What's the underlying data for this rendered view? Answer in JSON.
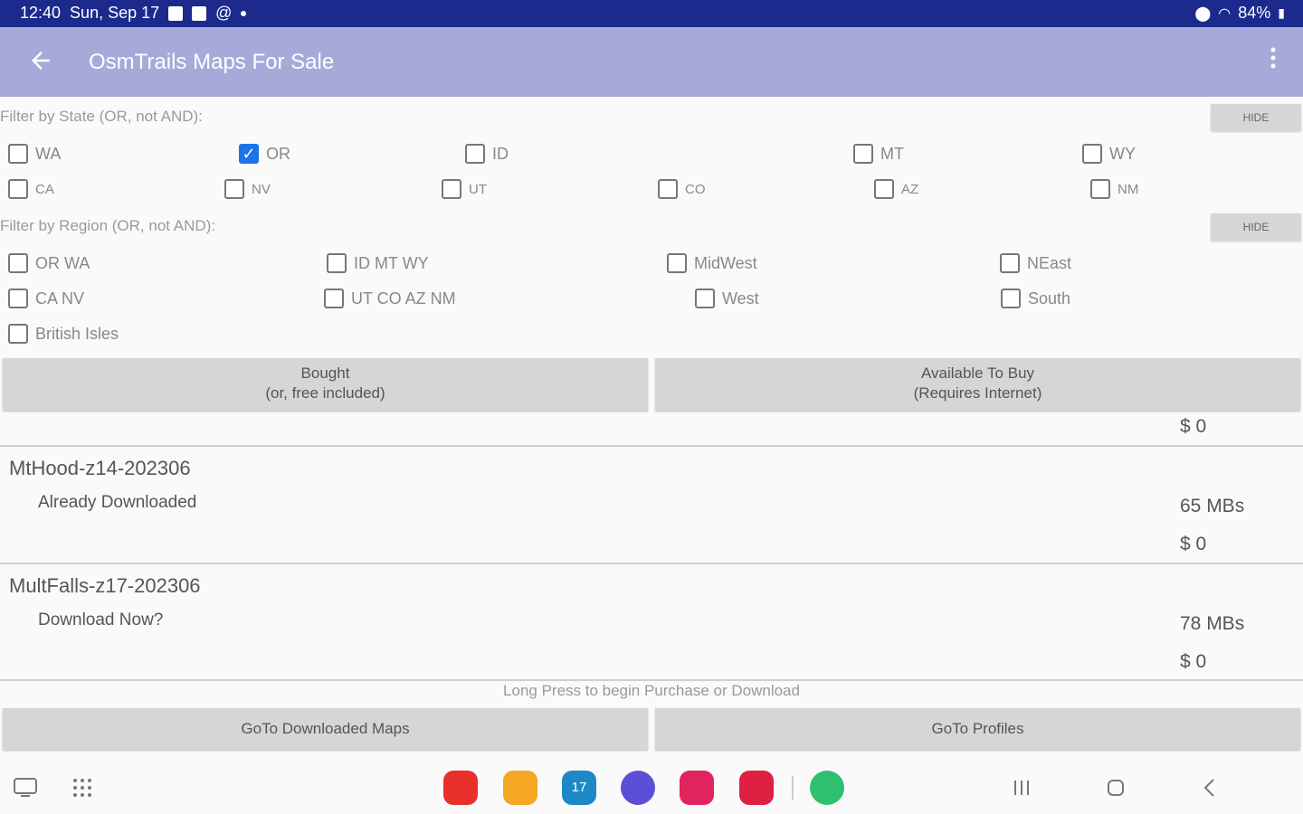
{
  "status_bar": {
    "time": "12:40",
    "date": "Sun, Sep 17",
    "battery": "84%",
    "left_icons": [
      "image-icon",
      "contact-icon",
      "at-icon"
    ],
    "right_icons": [
      "location-icon",
      "wifi-icon",
      "battery-icon"
    ]
  },
  "app_bar": {
    "title": "OsmTrails Maps For Sale",
    "back_icon": "arrow-back-icon",
    "menu_icon": "more-vert-icon"
  },
  "state_filter": {
    "label": "Filter by State (OR, not AND):",
    "hide_label": "HIDE",
    "options": [
      {
        "label": "WA",
        "checked": false
      },
      {
        "label": "OR",
        "checked": true
      },
      {
        "label": "ID",
        "checked": false
      },
      {
        "label": "MT",
        "checked": false
      },
      {
        "label": "WY",
        "checked": false
      },
      {
        "label": "CA",
        "checked": false
      },
      {
        "label": "NV",
        "checked": false
      },
      {
        "label": "UT",
        "checked": false
      },
      {
        "label": "CO",
        "checked": false
      },
      {
        "label": "AZ",
        "checked": false
      },
      {
        "label": "NM",
        "checked": false
      }
    ]
  },
  "region_filter": {
    "label": "Filter by Region (OR, not AND):",
    "hide_label": "HIDE",
    "options": [
      {
        "label": "OR WA",
        "checked": false
      },
      {
        "label": "ID MT WY",
        "checked": false
      },
      {
        "label": "MidWest",
        "checked": false
      },
      {
        "label": "NEast",
        "checked": false
      },
      {
        "label": "CA NV",
        "checked": false
      },
      {
        "label": "UT CO AZ NM",
        "checked": false
      },
      {
        "label": "West",
        "checked": false
      },
      {
        "label": "South",
        "checked": false
      },
      {
        "label": "British Isles",
        "checked": false
      }
    ]
  },
  "tabs": {
    "bought_line1": "Bought",
    "bought_line2": "(or, free included)",
    "available_line1": "Available To Buy",
    "available_line2": "(Requires Internet)"
  },
  "maps": {
    "partial_price": "$ 0",
    "items": [
      {
        "name": "MtHood-z14-202306",
        "status": "Already Downloaded",
        "size": "65 MBs",
        "price": "$ 0"
      },
      {
        "name": "MultFalls-z17-202306",
        "status": "Download Now?",
        "size": "78 MBs",
        "price": "$ 0"
      }
    ]
  },
  "hint": "Long Press to begin Purchase or Download",
  "bottom_buttons": {
    "downloaded": "GoTo Downloaded Maps",
    "profiles": "GoTo Profiles"
  },
  "dock": {
    "apps": [
      {
        "icon": "notes-app-icon",
        "color": "#e8312a"
      },
      {
        "icon": "files-app-icon",
        "color": "#f5a623"
      },
      {
        "icon": "calendar-app-icon",
        "color": "#1e88c7"
      },
      {
        "icon": "browser-app-icon",
        "color": "#5b4fd6"
      },
      {
        "icon": "gallery-app-icon",
        "color": "#e0245e"
      },
      {
        "icon": "screen-recorder-app-icon",
        "color": "#e02042"
      },
      {
        "icon": "android-app-icon",
        "color": "#2fbf71"
      }
    ],
    "calendar_day": "17"
  }
}
